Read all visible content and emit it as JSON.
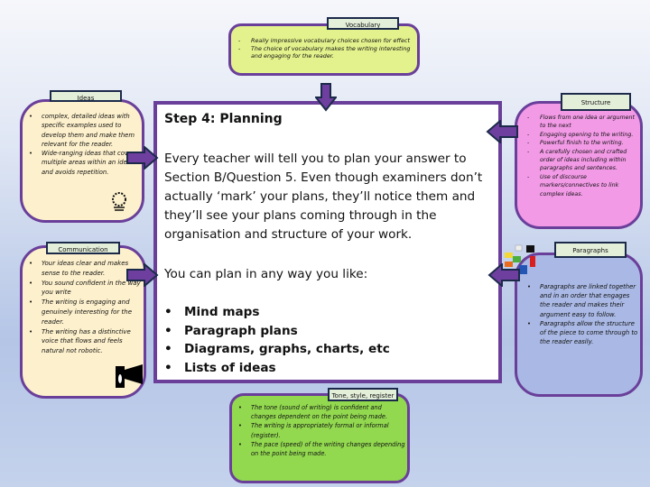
{
  "vocabulary": {
    "title": "Vocabulary",
    "items": [
      "Really impressive vocabulary choices chosen for effect",
      "The choice of vocabulary makes the writing interesting and engaging for the reader."
    ]
  },
  "ideas": {
    "title": "Ideas",
    "items": [
      "complex, detailed ideas with specific examples used to develop them and make them relevant for the reader.",
      "Wide-ranging ideas that cover multiple areas within an idea and avoids repetition."
    ]
  },
  "communication": {
    "title": "Communication",
    "items": [
      "Your ideas clear and makes sense to the reader.",
      "You sound confident in the way you write",
      "The writing is engaging and genuinely interesting for the reader.",
      "The writing has a distinctive voice that flows and feels natural not robotic."
    ]
  },
  "structure": {
    "title": "Structure",
    "items": [
      "Flows from one idea or argument to the next",
      "Engaging opening to the writing.",
      "Powerful finish to the writing.",
      "A carefully chosen and crafted order of ideas including within paragraphs and sentences.",
      "Use of discourse markers/connectives to link complex ideas."
    ]
  },
  "paragraphs": {
    "title": "Paragraphs",
    "items": [
      "Paragraphs are linked together and in an order that engages the reader and makes their argument easy to follow.",
      "Paragraphs allow the structure of the piece to come through to the reader easily."
    ]
  },
  "tone": {
    "title": "Tone, style, register",
    "items": [
      "The tone (sound of writing) is confident and changes dependent on the point being made.",
      "The writing is appropriately formal or informal (register).",
      "The pace (speed) of the writing changes depending on the point being made."
    ]
  },
  "main": {
    "heading": "Step 4: Planning",
    "paragraph": "Every teacher will tell you to plan your answer to Section B/Question 5. Even though examiners don’t actually ‘mark’ your plans, they’ll notice them and they’ll see your plans coming through in the organisation and structure of your work.",
    "intro": "You can plan in any way you like:",
    "methods": [
      "Mind maps",
      "Paragraph plans",
      "Diagrams, graphs, charts, etc",
      "Lists of ideas"
    ]
  },
  "colors": {
    "vocabulary_bg": "#e3f28c",
    "ideas_bg": "#fdf0cc",
    "communication_bg": "#fdf0cc",
    "structure_bg": "#f29ae6",
    "paragraphs_bg": "#a9b8e4",
    "tone_bg": "#92d94f",
    "border": "#6a3f9a",
    "arrow_fill": "#6f3fa0",
    "arrow_outline": "#1c2a4a"
  }
}
